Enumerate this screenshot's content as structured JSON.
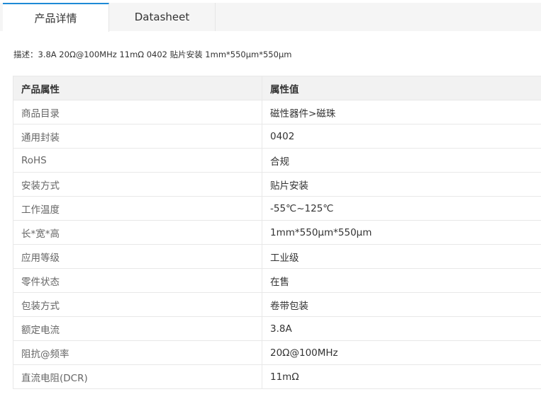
{
  "tabs": {
    "details_label": "产品详情",
    "datasheet_label": "Datasheet"
  },
  "description": {
    "label": "描述：",
    "text": "3.8A 20Ω@100MHz 11mΩ 0402 贴片安装 1mm*550μm*550μm"
  },
  "table": {
    "header": {
      "name": "产品属性",
      "value": "属性值"
    },
    "rows": [
      {
        "name": "商品目录",
        "value": "磁性器件>磁珠"
      },
      {
        "name": "通用封装",
        "value": "0402"
      },
      {
        "name": "RoHS",
        "value": "合规"
      },
      {
        "name": "安装方式",
        "value": "贴片安装"
      },
      {
        "name": "工作温度",
        "value": "-55℃~125℃"
      },
      {
        "name": "长*宽*高",
        "value": "1mm*550μm*550μm"
      },
      {
        "name": "应用等级",
        "value": "工业级"
      },
      {
        "name": "零件状态",
        "value": "在售"
      },
      {
        "name": "包装方式",
        "value": "卷带包装"
      },
      {
        "name": "额定电流",
        "value": "3.8A"
      },
      {
        "name": "阻抗@频率",
        "value": "20Ω@100MHz"
      },
      {
        "name": "直流电阻(DCR)",
        "value": "11mΩ"
      }
    ]
  },
  "colors": {
    "active_tab_accent": "#1e8ad6",
    "tab_inactive_bg": "#f5f5f5",
    "table_header_bg": "#f2f2f2",
    "border": "#e8e8e8"
  }
}
